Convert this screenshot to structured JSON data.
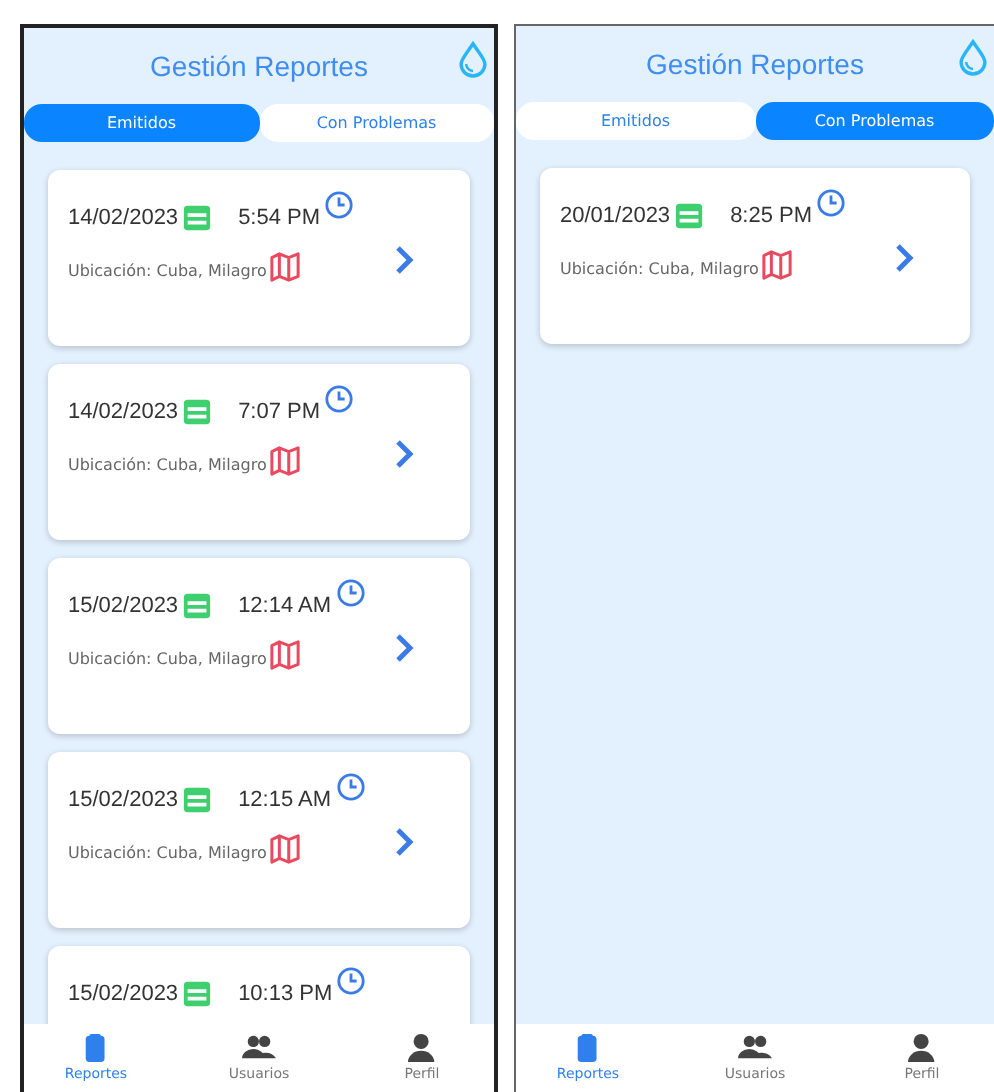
{
  "screens": [
    {
      "title": "Gestión Reportes",
      "tabs": [
        {
          "label": "Emitidos",
          "selected": true
        },
        {
          "label": "Con Problemas",
          "selected": false
        }
      ],
      "reports": [
        {
          "date": "14/02/2023",
          "time": "5:54 PM",
          "location": "Ubicación: Cuba, Milagro"
        },
        {
          "date": "14/02/2023",
          "time": "7:07 PM",
          "location": "Ubicación: Cuba, Milagro"
        },
        {
          "date": "15/02/2023",
          "time": "12:14 AM",
          "location": "Ubicación: Cuba, Milagro"
        },
        {
          "date": "15/02/2023",
          "time": "12:15 AM",
          "location": "Ubicación: Cuba, Milagro"
        },
        {
          "date": "15/02/2023",
          "time": "10:13 PM"
        }
      ],
      "nav": [
        {
          "label": "Reportes",
          "kind": "clipboard",
          "selected": true
        },
        {
          "label": "Usuarios",
          "kind": "users",
          "selected": false
        },
        {
          "label": "Perfil",
          "kind": "person",
          "selected": false
        }
      ]
    },
    {
      "title": "Gestión Reportes",
      "tabs": [
        {
          "label": "Emitidos",
          "selected": false
        },
        {
          "label": "Con Problemas",
          "selected": true
        }
      ],
      "reports": [
        {
          "date": "20/01/2023",
          "time": "8:25 PM",
          "location": "Ubicación: Cuba, Milagro"
        }
      ],
      "nav": [
        {
          "label": "Reportes",
          "kind": "clipboard",
          "selected": true
        },
        {
          "label": "Usuarios",
          "kind": "users",
          "selected": false
        },
        {
          "label": "Perfil",
          "kind": "person",
          "selected": false
        }
      ]
    }
  ]
}
